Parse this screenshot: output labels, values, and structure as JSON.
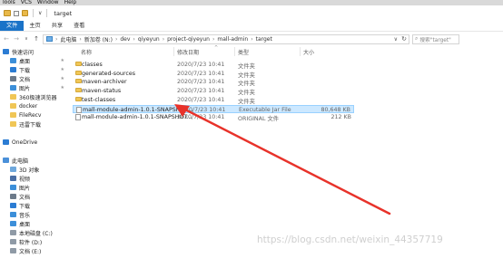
{
  "menubar": {
    "items": [
      "Tools",
      "VCS",
      "Window",
      "Help"
    ]
  },
  "titlebar": {
    "title": "target"
  },
  "ribbon": {
    "tabs": [
      "文件",
      "主页",
      "共享",
      "查看"
    ]
  },
  "address": {
    "crumbs": [
      "此电脑",
      "新加卷 (N:)",
      "dev",
      "qiyeyun",
      "project-qiyeyun",
      "mall-admin",
      "target"
    ]
  },
  "search": {
    "placeholder": "搜索\"target\""
  },
  "columns": {
    "name": "名称",
    "date": "修改日期",
    "type": "类型",
    "size": "大小"
  },
  "nav": {
    "items": [
      {
        "label": "快速访问",
        "icon": "star-icon",
        "pinned": false
      },
      {
        "label": "桌面",
        "icon": "desktop-icon",
        "pinned": true
      },
      {
        "label": "下载",
        "icon": "download-icon",
        "pinned": true
      },
      {
        "label": "文档",
        "icon": "document-icon",
        "pinned": true
      },
      {
        "label": "图片",
        "icon": "picture-icon",
        "pinned": true
      },
      {
        "label": "360极速浏览器",
        "icon": "folder-icon",
        "pinned": false
      },
      {
        "label": "docker",
        "icon": "folder-icon",
        "pinned": false
      },
      {
        "label": "FileRecv",
        "icon": "folder-icon",
        "pinned": false
      },
      {
        "label": "迅雷下载",
        "icon": "folder-icon",
        "pinned": false
      },
      {
        "label": "",
        "icon": "",
        "pinned": false
      },
      {
        "label": "OneDrive",
        "icon": "cloud-icon",
        "pinned": false
      },
      {
        "label": "",
        "icon": "",
        "pinned": false
      },
      {
        "label": "此电脑",
        "icon": "computer-icon",
        "pinned": false
      },
      {
        "label": "3D 对象",
        "icon": "cube-icon",
        "pinned": false
      },
      {
        "label": "视频",
        "icon": "video-icon",
        "pinned": false
      },
      {
        "label": "图片",
        "icon": "picture-icon",
        "pinned": false
      },
      {
        "label": "文档",
        "icon": "document-icon",
        "pinned": false
      },
      {
        "label": "下载",
        "icon": "download-icon",
        "pinned": false
      },
      {
        "label": "音乐",
        "icon": "music-icon",
        "pinned": false
      },
      {
        "label": "桌面",
        "icon": "desktop-icon",
        "pinned": false
      },
      {
        "label": "本地磁盘 (C:)",
        "icon": "drive-icon",
        "pinned": false
      },
      {
        "label": "软件 (D:)",
        "icon": "drive-icon",
        "pinned": false
      },
      {
        "label": "文档 (E:)",
        "icon": "drive-icon",
        "pinned": false
      }
    ]
  },
  "files": [
    {
      "name": "classes",
      "date": "2020/7/23 10:41",
      "type": "文件夹",
      "size": "",
      "kind": "folder"
    },
    {
      "name": "generated-sources",
      "date": "2020/7/23 10:41",
      "type": "文件夹",
      "size": "",
      "kind": "folder"
    },
    {
      "name": "maven-archiver",
      "date": "2020/7/23 10:41",
      "type": "文件夹",
      "size": "",
      "kind": "folder"
    },
    {
      "name": "maven-status",
      "date": "2020/7/23 10:41",
      "type": "文件夹",
      "size": "",
      "kind": "folder"
    },
    {
      "name": "test-classes",
      "date": "2020/7/23 10:41",
      "type": "文件夹",
      "size": "",
      "kind": "folder"
    },
    {
      "name": "mall-module-admin-1.0.1-SNAPSHOT...",
      "date": "2020/7/23 10:41",
      "type": "Executable Jar File",
      "size": "80,648 KB",
      "kind": "jar"
    },
    {
      "name": "mall-module-admin-1.0.1-SNAPSHOT...",
      "date": "2020/7/23 10:41",
      "type": "ORIGINAL 文件",
      "size": "212 KB",
      "kind": "file"
    }
  ],
  "watermark": "https://blog.csdn.net/weixin_44357719",
  "colors": {
    "accent": "#1a73c8",
    "selection": "#cce8ff",
    "arrow": "#e8322a",
    "folder": "#f0c656"
  }
}
